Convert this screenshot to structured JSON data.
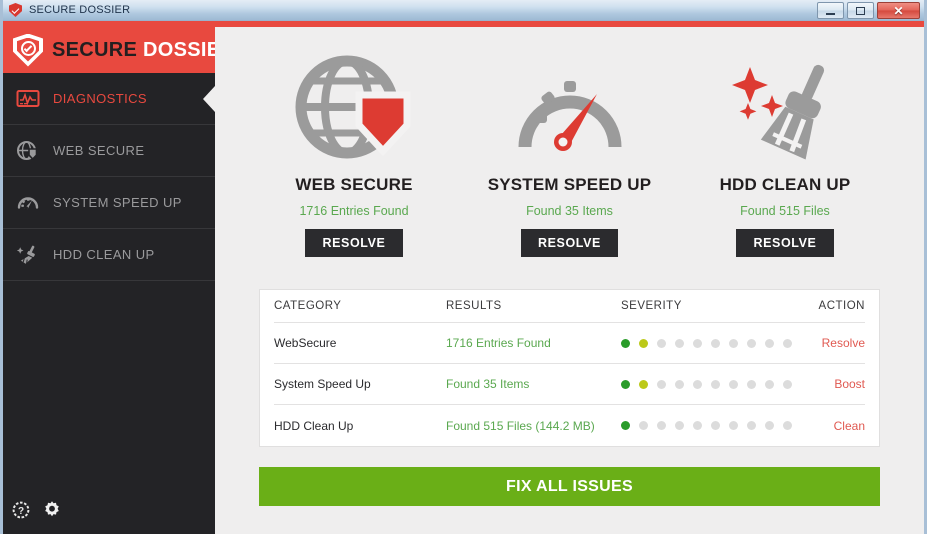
{
  "titlebar": {
    "title": "SECURE DOSSIER",
    "icon": "shield-icon",
    "minimize_label": "",
    "maximize_label": "",
    "close_label": "✕"
  },
  "sidebar": {
    "brand_part1": "SECURE ",
    "brand_part2": "DOSSIER",
    "brand_icon": "shield-check-icon",
    "items": [
      {
        "label": "DIAGNOSTICS",
        "icon": "pulse-monitor-icon",
        "active": true
      },
      {
        "label": "WEB SECURE",
        "icon": "globe-shield-icon",
        "active": false
      },
      {
        "label": "SYSTEM SPEED UP",
        "icon": "speedometer-icon",
        "active": false
      },
      {
        "label": "HDD CLEAN UP",
        "icon": "broom-icon",
        "active": false
      }
    ],
    "bottom_icons": [
      {
        "name": "help-icon"
      },
      {
        "name": "gear-icon"
      }
    ]
  },
  "cards": [
    {
      "title": "WEB SECURE",
      "status": "1716 Entries Found",
      "button": "RESOLVE",
      "icon": "globe-shield-icon"
    },
    {
      "title": "SYSTEM SPEED UP",
      "status": "Found 35 Items",
      "button": "RESOLVE",
      "icon": "speedometer-icon"
    },
    {
      "title": "HDD CLEAN UP",
      "status": "Found 515 Files",
      "button": "RESOLVE",
      "icon": "broom-sparkle-icon"
    }
  ],
  "table": {
    "headers": {
      "category": "CATEGORY",
      "results": "RESULTS",
      "severity": "SEVERITY",
      "action": "ACTION"
    },
    "rows": [
      {
        "category": "WebSecure",
        "results": "1716 Entries Found",
        "severity_total": 10,
        "severity_filled": 2,
        "action": "Resolve"
      },
      {
        "category": "System Speed Up",
        "results": "Found 35 Items",
        "severity_total": 10,
        "severity_filled": 2,
        "action": "Boost"
      },
      {
        "category": "HDD Clean Up",
        "results": "Found 515 Files (144.2 MB)",
        "severity_total": 10,
        "severity_filled": 1,
        "action": "Clean"
      }
    ]
  },
  "footer": {
    "fix_all_label": "FIX ALL ISSUES"
  },
  "colors": {
    "accent_red": "#e8493f",
    "sidebar_dark": "#232326",
    "status_green": "#5aa84f",
    "fix_all_green": "#6aaf17",
    "severity_high": "#2a9c2a",
    "severity_mid": "#bcc919",
    "severity_empty": "#dcdcdc"
  }
}
